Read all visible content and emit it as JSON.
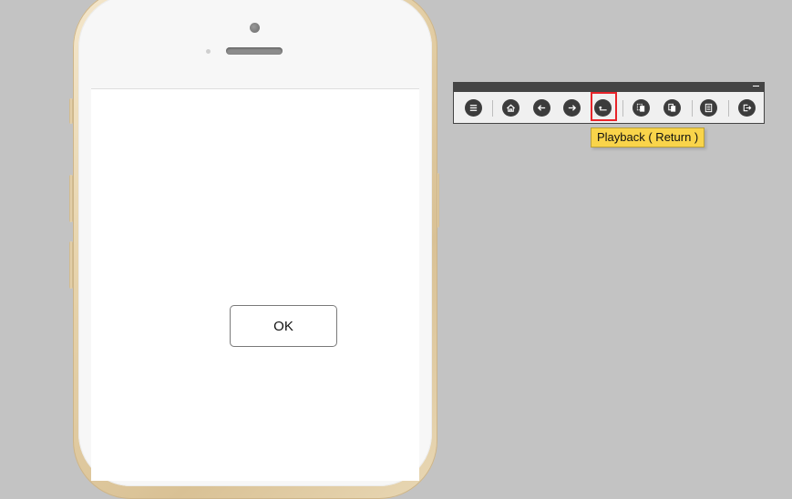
{
  "phone": {
    "ok_label": "OK"
  },
  "toolbar": {
    "buttons": [
      {
        "icon": "menu-icon"
      },
      {
        "icon": "home-icon"
      },
      {
        "icon": "arrow-left-icon"
      },
      {
        "icon": "arrow-right-icon"
      },
      {
        "icon": "return-icon"
      },
      {
        "icon": "copy-icon"
      },
      {
        "icon": "paste-icon"
      },
      {
        "icon": "document-icon"
      },
      {
        "icon": "exit-icon"
      }
    ],
    "tooltip": "Playback ( Return )"
  },
  "colors": {
    "background": "#c3c3c3",
    "highlight": "#e8242a",
    "tooltip_bg": "#f9d44a",
    "toolbar_dark": "#3c3c3c"
  }
}
